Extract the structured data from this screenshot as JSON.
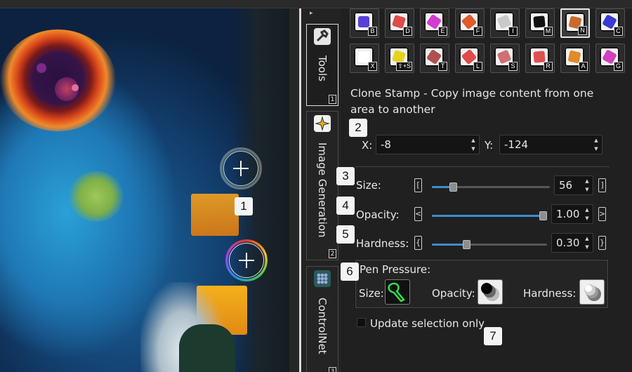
{
  "app": {
    "collapse_arrow": "▸"
  },
  "canvas": {
    "callouts": [
      "1"
    ]
  },
  "side_tabs": [
    {
      "label": "Tools",
      "number": "1",
      "icon": "wrench-icon"
    },
    {
      "label": "Image Generation",
      "number": "2",
      "icon": "sparkles-icon"
    },
    {
      "label": "ControlNet",
      "number": "3",
      "icon": "network-icon"
    }
  ],
  "tools": {
    "row1": [
      {
        "name": "brush-tool",
        "key": "B",
        "icon": "brush-icon",
        "color": "#5a3fd6"
      },
      {
        "name": "eraser-tool",
        "key": "D",
        "icon": "eraser-icon",
        "color": "#e04a4a"
      },
      {
        "name": "layers-tool",
        "key": "E",
        "icon": "layers-icon",
        "color": "#d23ad0"
      },
      {
        "name": "fill-tool",
        "key": "F",
        "icon": "fill-bucket-icon",
        "color": "#e05a2a"
      },
      {
        "name": "filter-tool",
        "key": "I",
        "icon": "funnel-icon",
        "color": "#c9c9c9"
      },
      {
        "name": "gradient-tool",
        "key": "M",
        "icon": "gradient-icon",
        "color": "#111111"
      },
      {
        "name": "clone-stamp-tool",
        "key": "N",
        "icon": "stamp-icon",
        "color": "#c96a2a",
        "active": true
      },
      {
        "name": "eyedropper-tool",
        "key": "C",
        "icon": "eyedropper-icon",
        "color": "#3a3ad0"
      }
    ],
    "row2": [
      {
        "name": "text-tool",
        "key": "X",
        "icon": "text-icon",
        "color": "#ffffff"
      },
      {
        "name": "shape-tool",
        "key": "⇧+S",
        "icon": "shapes-icon",
        "color": "#e8d020"
      },
      {
        "name": "transform-tool",
        "key": "T",
        "icon": "transform-icon",
        "color": "#b05050"
      },
      {
        "name": "lasso-tool",
        "key": "L",
        "icon": "lasso-icon",
        "color": "#e04a4a"
      },
      {
        "name": "smudge-tool",
        "key": "S",
        "icon": "smudge-icon",
        "color": "#d07070"
      },
      {
        "name": "rectangle-select-tool",
        "key": "R",
        "icon": "rect-select-icon",
        "color": "#e05050"
      },
      {
        "name": "auto-select-tool",
        "key": "A",
        "icon": "auto-select-icon",
        "color": "#e08a2a"
      },
      {
        "name": "generate-select-tool",
        "key": "G",
        "icon": "generate-icon",
        "color": "#d040c0"
      }
    ]
  },
  "panel": {
    "description": "Clone Stamp - Copy image content from one area to another",
    "offset": {
      "x_label": "X:",
      "x_value": "-8",
      "y_label": "Y:",
      "y_value": "-124"
    },
    "size": {
      "label": "Size:",
      "value": "56",
      "level": 0.18
    },
    "opacity": {
      "label": "Opacity:",
      "value": "1.00",
      "level": 1.0
    },
    "hardness": {
      "label": "Hardness:",
      "value": "0.30",
      "level": 0.3
    },
    "pen_pressure": {
      "title": "Pen Pressure:",
      "size_label": "Size:",
      "opacity_label": "Opacity:",
      "hardness_label": "Hardness:"
    },
    "update_selection_label": "Update selection only",
    "callouts": [
      "2",
      "3",
      "4",
      "5",
      "6",
      "7"
    ]
  }
}
